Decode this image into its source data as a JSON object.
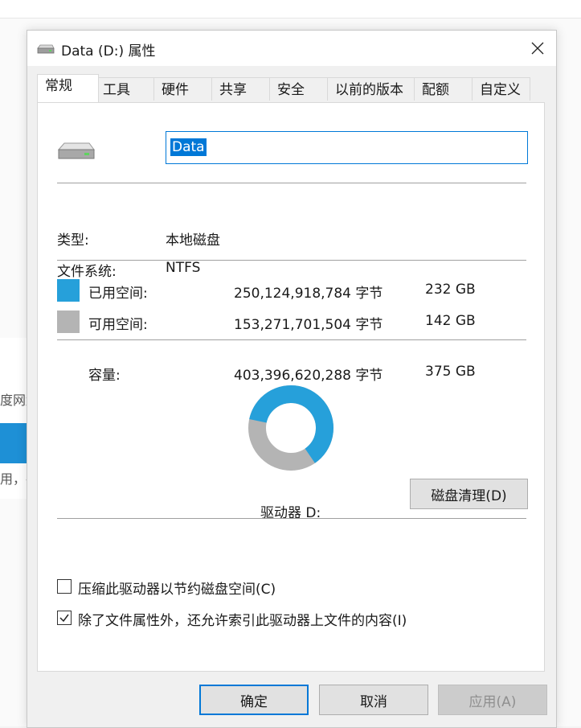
{
  "background": {
    "text1": "度网盘",
    "text2": "用，共"
  },
  "dialog": {
    "title": "Data (D:) 属性",
    "close_icon": "close-icon",
    "tabs": [
      "常规",
      "工具",
      "硬件",
      "共享",
      "安全",
      "以前的版本",
      "配额",
      "自定义"
    ],
    "active_tab": "常规",
    "general": {
      "volume_name": "Data",
      "type_label": "类型:",
      "type_value": "本地磁盘",
      "fs_label": "文件系统:",
      "fs_value": "NTFS",
      "used": {
        "label": "已用空间:",
        "bytes": "250,124,918,784 字节",
        "size": "232 GB",
        "color": "#26a0da"
      },
      "free": {
        "label": "可用空间:",
        "bytes": "153,271,701,504 字节",
        "size": "142 GB",
        "color": "#b4b4b4"
      },
      "capacity": {
        "label": "容量:",
        "bytes": "403,396,620,288 字节",
        "size": "375 GB"
      },
      "used_fraction": 0.62,
      "drive_label": "驱动器 D:",
      "cleanup_button": "磁盘清理(D)",
      "compress_checkbox": {
        "label": "压缩此驱动器以节约磁盘空间(C)",
        "checked": false
      },
      "index_checkbox": {
        "label": "除了文件属性外，还允许索引此驱动器上文件的内容(I)",
        "checked": true
      }
    },
    "buttons": {
      "ok": "确定",
      "cancel": "取消",
      "apply": "应用(A)"
    }
  }
}
